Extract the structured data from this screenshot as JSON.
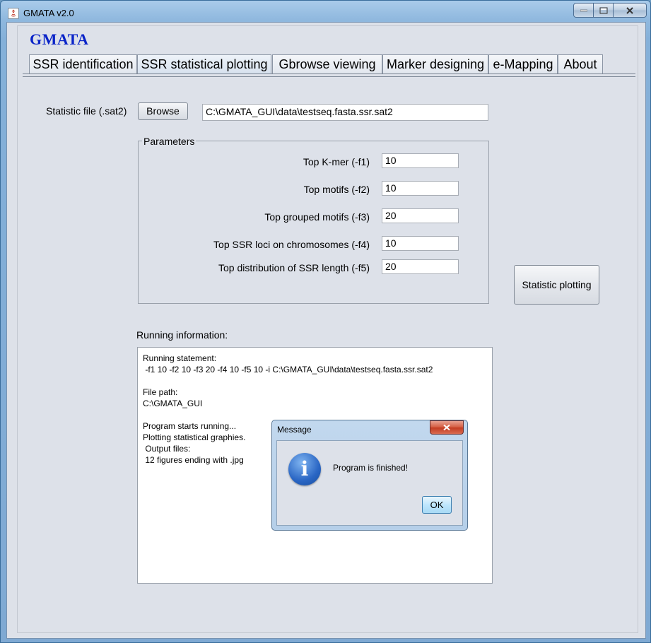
{
  "window": {
    "title": "GMATA v2.0"
  },
  "brand": "GMATA",
  "tabs": [
    "SSR identification",
    "SSR statistical plotting",
    "Gbrowse viewing",
    "Marker designing",
    "e-Mapping",
    "About"
  ],
  "form": {
    "statistic_file_label": "Statistic file (.sat2)",
    "browse_label": "Browse",
    "statistic_file_value": "C:\\GMATA_GUI\\data\\testseq.fasta.ssr.sat2",
    "parameters_legend": "Parameters",
    "params": [
      {
        "label": "Top K-mer (-f1)",
        "value": "10"
      },
      {
        "label": "Top motifs (-f2)",
        "value": "10"
      },
      {
        "label": "Top grouped motifs (-f3)",
        "value": "20"
      },
      {
        "label": "Top SSR loci on chromosomes  (-f4)",
        "value": "10"
      },
      {
        "label": "Top distribution of SSR length (-f5)",
        "value": "20"
      }
    ],
    "plot_button_label": "Statistic plotting"
  },
  "running": {
    "label": "Running information:",
    "lines": [
      "Running statement:",
      " -f1 10 -f2 10 -f3 20 -f4 10 -f5 10 -i C:\\GMATA_GUI\\data\\testseq.fasta.ssr.sat2",
      "",
      "File path:",
      "C:\\GMATA_GUI",
      "",
      "Program starts running...",
      "Plotting statistical graphies.",
      " Output files:",
      " 12 figures ending with .jpg"
    ]
  },
  "dialog": {
    "title": "Message",
    "icon": "info-icon",
    "message": "Program is finished!",
    "ok_label": "OK"
  }
}
